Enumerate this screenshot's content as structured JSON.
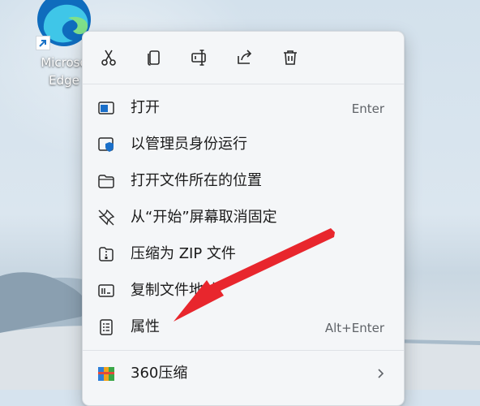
{
  "desktop_icon": {
    "name_line1": "Microso",
    "name_line2": "Edge"
  },
  "context_menu": {
    "toolbar": [
      "cut-icon",
      "copy-icon",
      "rename-icon",
      "share-icon",
      "delete-icon"
    ],
    "items": [
      {
        "label": "打开",
        "accelerator": "Enter",
        "icon": "open-window-icon"
      },
      {
        "label": "以管理员身份运行",
        "accelerator": "",
        "icon": "admin-shield-icon"
      },
      {
        "label": "打开文件所在的位置",
        "accelerator": "",
        "icon": "folder-icon"
      },
      {
        "label": "从“开始”屏幕取消固定",
        "accelerator": "",
        "icon": "unpin-icon"
      },
      {
        "label": "压缩为 ZIP 文件",
        "accelerator": "",
        "icon": "zip-icon"
      },
      {
        "label": "复制文件地址",
        "accelerator": "",
        "icon": "copy-path-icon"
      },
      {
        "label": "属性",
        "accelerator": "Alt+Enter",
        "icon": "properties-icon"
      },
      {
        "label": "360压缩",
        "accelerator": "",
        "icon": "archive-360-icon",
        "has_submenu": true
      }
    ]
  },
  "annotation": {
    "arrow_color": "#e8262d",
    "points_to": "属性"
  }
}
